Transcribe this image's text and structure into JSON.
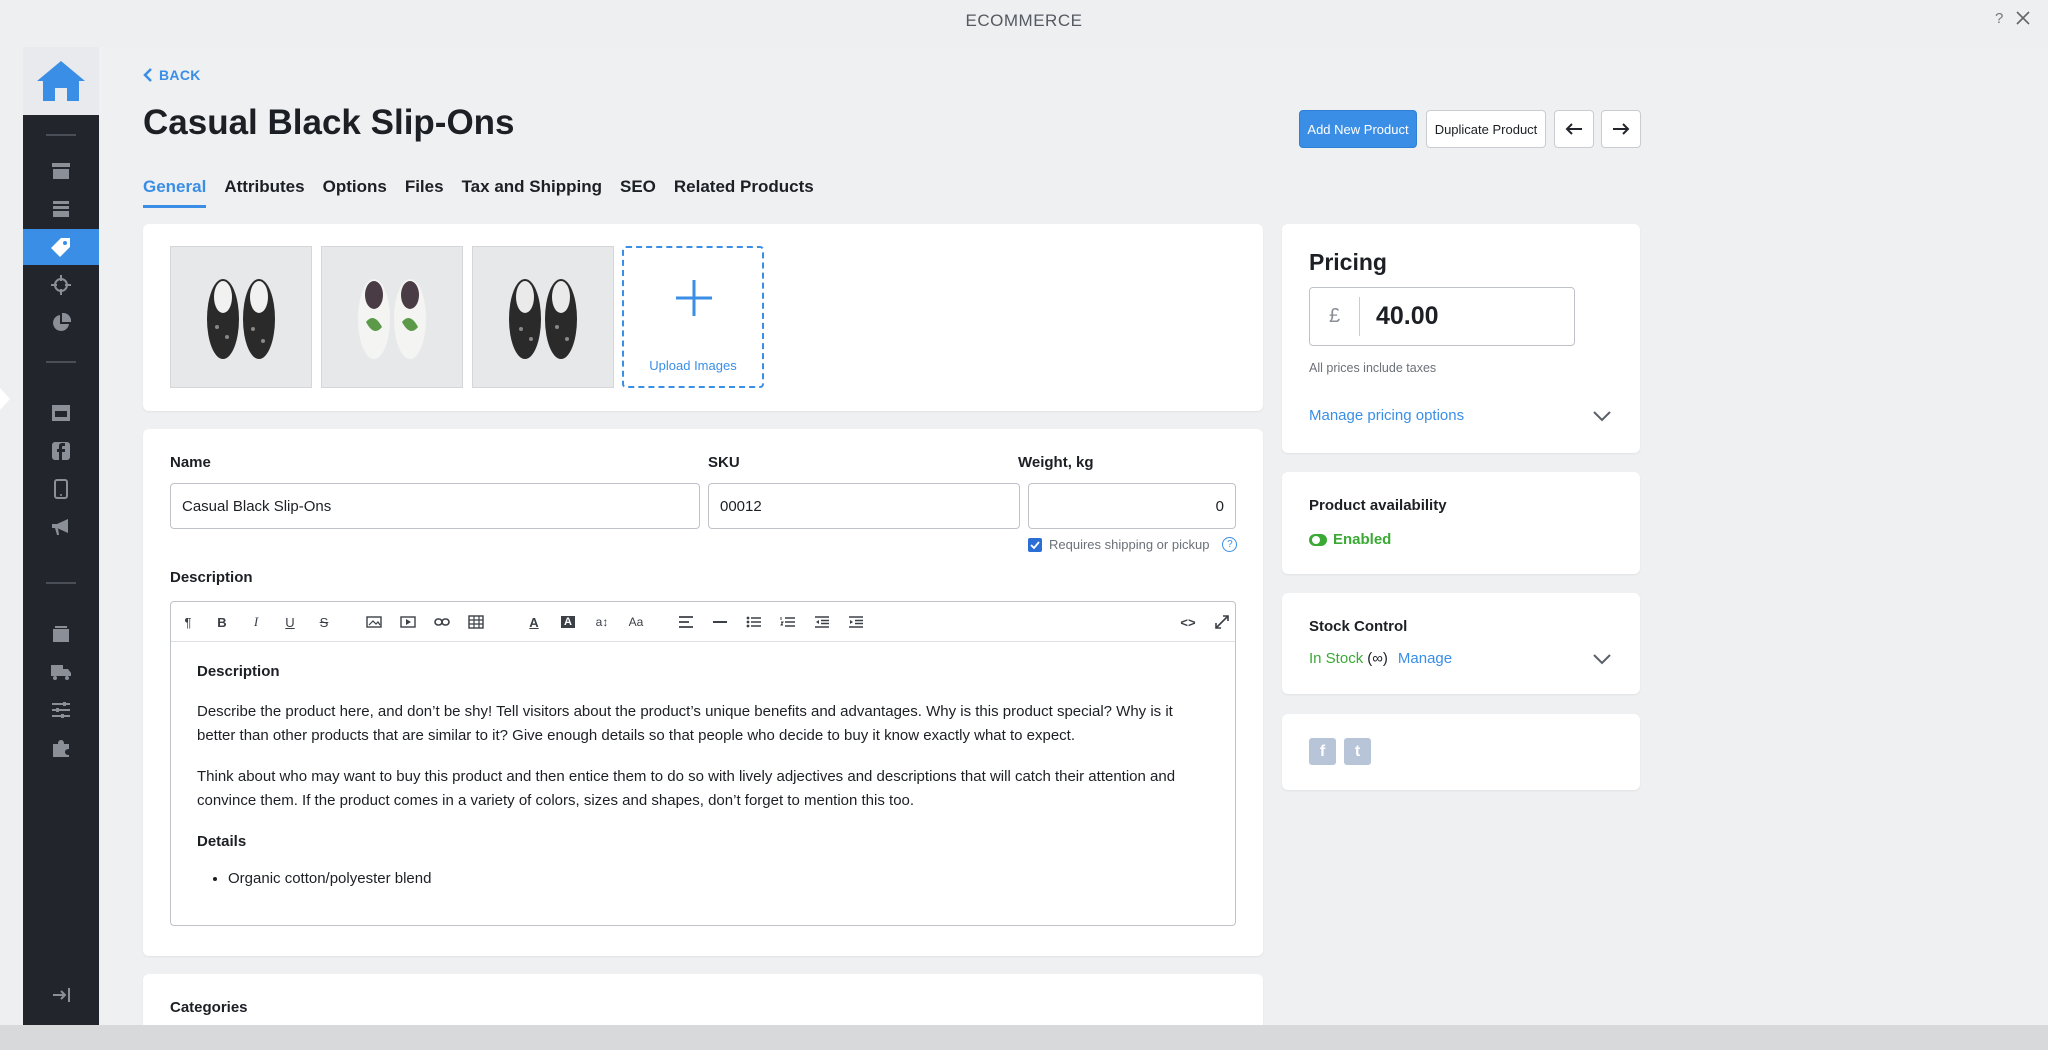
{
  "window": {
    "title": "ECOMMERCE",
    "help": "?"
  },
  "header": {
    "back_label": "BACK",
    "title": "Casual Black Slip-Ons",
    "add_new_label": "Add New Product",
    "duplicate_label": "Duplicate Product"
  },
  "tabs": [
    {
      "label": "General"
    },
    {
      "label": "Attributes"
    },
    {
      "label": "Options"
    },
    {
      "label": "Files"
    },
    {
      "label": "Tax and Shipping"
    },
    {
      "label": "SEO"
    },
    {
      "label": "Related Products"
    }
  ],
  "images": {
    "upload_label": "Upload Images"
  },
  "form": {
    "name_label": "Name",
    "name_value": "Casual Black Slip-Ons",
    "sku_label": "SKU",
    "sku_value": "00012",
    "weight_label": "Weight, kg",
    "weight_value": "0",
    "shipping_label": "Requires shipping or pickup",
    "description_label": "Description"
  },
  "editor": {
    "heading": "Description",
    "paragraph_1": "Describe the product here, and don’t be shy! Tell visitors about the product’s unique benefits and advantages. Why is this product special? Why is it better than other products that are similar to it? Give enough details so that people who decide to buy it know exactly what to expect.",
    "paragraph_2": "Think about who may want to buy this product and then entice them to do so with lively adjectives and descriptions that will catch their attention and convince them. If the product comes in a variety of colors, sizes and shapes, don’t forget to mention this too.",
    "details_heading": "Details",
    "bullet_1": "Organic cotton/polyester blend"
  },
  "categories": {
    "label": "Categories"
  },
  "pricing": {
    "title": "Pricing",
    "currency": "£",
    "price": "40.00",
    "note": "All prices include taxes",
    "manage_label": "Manage pricing options"
  },
  "availability": {
    "title": "Product availability",
    "status": "Enabled"
  },
  "stock": {
    "title": "Stock Control",
    "status": "In Stock",
    "qty": "(∞)",
    "manage_label": "Manage"
  },
  "social": {
    "facebook": "f",
    "twitter": "t"
  },
  "colors": {
    "accent": "#3a8ee6",
    "sidebar": "#22252b",
    "success": "#3aaa35"
  }
}
